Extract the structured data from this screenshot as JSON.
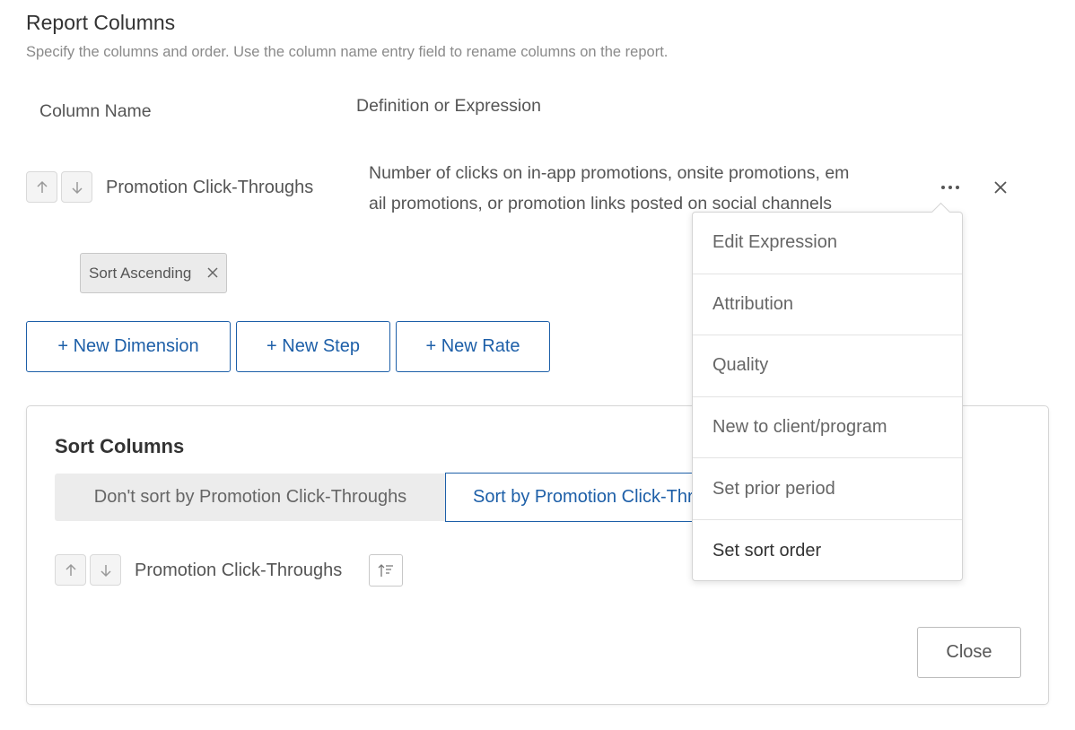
{
  "header": {
    "title": "Report Columns",
    "subtitle": "Specify the columns and order. Use the column name entry field to rename columns on the report."
  },
  "columns_table": {
    "column_name_header": "Column Name",
    "definition_header": "Definition or Expression",
    "rows": [
      {
        "name": "Promotion Click-Throughs",
        "definition_line1": "Number of clicks on in-app promotions, onsite promotions, em",
        "definition_line2": "ail promotions, or promotion links posted on social channels",
        "sort_tag": "Sort Ascending"
      }
    ]
  },
  "buttons": {
    "new_dimension": "+ New Dimension",
    "new_step": "+ New Step",
    "new_rate": "+ New Rate"
  },
  "sort_panel": {
    "title": "Sort Columns",
    "toggle_off_label": "Don't sort by Promotion Click-Throughs",
    "toggle_on_label": "Sort by Promotion Click-Throughs",
    "rows": [
      {
        "name": "Promotion Click-Throughs"
      }
    ],
    "close_label": "Close"
  },
  "context_menu": {
    "items": [
      "Edit Expression",
      "Attribution",
      "Quality",
      "New to client/program",
      "Set prior period",
      "Set sort order"
    ]
  },
  "colors": {
    "accent": "#1d5fa8",
    "text_muted": "#8a8a8a",
    "toggle_off_bg": "#ececec"
  }
}
